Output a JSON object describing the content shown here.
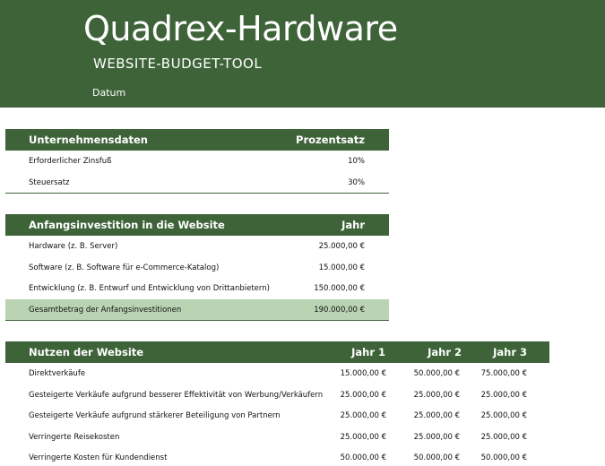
{
  "header": {
    "title": "Quadrex-Hardware",
    "subtitle": "WEBSITE-BUDGET-TOOL",
    "date_label": "Datum"
  },
  "company": {
    "heading": "Unternehmensdaten",
    "col": "Prozentsatz",
    "rows": [
      {
        "label": "Erforderlicher Zinsfuß",
        "value": "10%"
      },
      {
        "label": "Steuersatz",
        "value": "30%"
      }
    ]
  },
  "investment": {
    "heading": "Anfangsinvestition in die Website",
    "col": "Jahr",
    "rows": [
      {
        "label": "Hardware (z. B. Server)",
        "value": "25.000,00 €"
      },
      {
        "label": "Software (z. B. Software für e-Commerce-Katalog)",
        "value": "15.000,00 €"
      },
      {
        "label": "Entwicklung (z. B. Entwurf und Entwicklung von Drittanbietern)",
        "value": "150.000,00 €"
      }
    ],
    "total": {
      "label": "Gesamtbetrag der Anfangsinvestitionen",
      "value": "190.000,00 €"
    }
  },
  "benefits": {
    "heading": "Nutzen der Website",
    "cols": [
      "Jahr 1",
      "Jahr 2",
      "Jahr 3"
    ],
    "rows": [
      {
        "label": "Direktverkäufe",
        "values": [
          "15.000,00 €",
          "50.000,00 €",
          "75.000,00 €"
        ]
      },
      {
        "label": "Gesteigerte Verkäufe aufgrund besserer Effektivität von Werbung/Verkäufern",
        "values": [
          "25.000,00 €",
          "25.000,00 €",
          "25.000,00 €"
        ]
      },
      {
        "label": "Gesteigerte Verkäufe aufgrund stärkerer Beteiligung von Partnern",
        "values": [
          "25.000,00 €",
          "25.000,00 €",
          "25.000,00 €"
        ]
      },
      {
        "label": "Verringerte Reisekosten",
        "values": [
          "25.000,00 €",
          "25.000,00 €",
          "25.000,00 €"
        ]
      },
      {
        "label": "Verringerte Kosten für Kundendienst",
        "values": [
          "50.000,00 €",
          "50.000,00 €",
          "50.000,00 €"
        ]
      }
    ]
  }
}
